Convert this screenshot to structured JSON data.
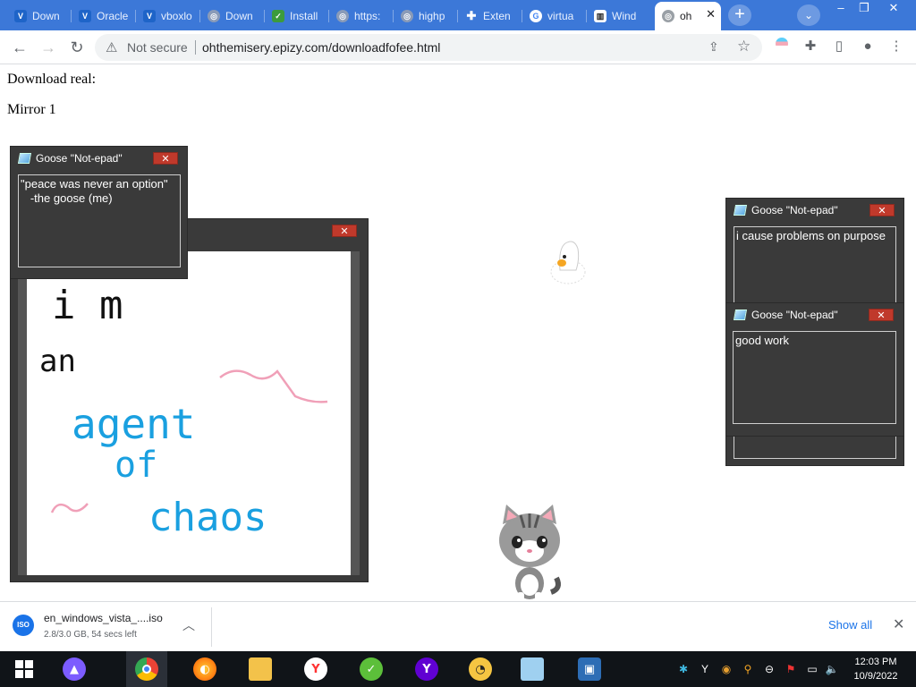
{
  "tabs": [
    {
      "label": "Down",
      "icon": "vbox-icon",
      "color": "#1e64c8"
    },
    {
      "label": "Oracle",
      "icon": "vbox-icon",
      "color": "#1e64c8"
    },
    {
      "label": "vboxlo",
      "icon": "vbox-icon",
      "color": "#1e64c8"
    },
    {
      "label": "Down",
      "icon": "globe-icon",
      "color": "#9aa0a6"
    },
    {
      "label": "Install",
      "icon": "leaf-icon",
      "color": "#3c9b3c"
    },
    {
      "label": "https:",
      "icon": "globe-icon",
      "color": "#9aa0a6"
    },
    {
      "label": "highp",
      "icon": "globe-icon",
      "color": "#9aa0a6"
    },
    {
      "label": "Exten",
      "icon": "puzzle-icon",
      "color": "#9aa0a6"
    },
    {
      "label": "virtua",
      "icon": "google-icon",
      "color": "#ffffff"
    },
    {
      "label": "Wind",
      "icon": "archive-icon",
      "color": "#ffffff"
    },
    {
      "label": "oh",
      "icon": "globe-icon",
      "color": "#9aa0a6",
      "active": true
    }
  ],
  "addressbar": {
    "security": "Not secure",
    "url": "ohthemisery.epizy.com/downloadfofee.html"
  },
  "page": {
    "download_real": "Download real:",
    "mirror1": "Mirror 1"
  },
  "goose_windows": {
    "title": "Goose \"Not-epad\"",
    "close": "✕",
    "note1": "\"peace was never an option\"\n   -the goose (me)",
    "note2": "i cause problems on purpose",
    "note3": "good work"
  },
  "drawing": {
    "line1": "i m",
    "line2": "an",
    "line3": "agent",
    "line4": "of",
    "line5": "chaos"
  },
  "download": {
    "filename": "en_windows_vista_....iso",
    "status": "2.8/3.0 GB, 54 secs left",
    "show_all": "Show all",
    "file_badge": "ISO"
  },
  "taskbar": {
    "time": "12:03 PM",
    "date": "10/9/2022"
  },
  "colors": {
    "tabstrip": "#3c78d8",
    "goose_window": "#3a3a3a",
    "close_red": "#c0392b",
    "ink_black": "#111111",
    "ink_blue": "#1aa0e0",
    "ink_pink": "#f0a0b8"
  }
}
